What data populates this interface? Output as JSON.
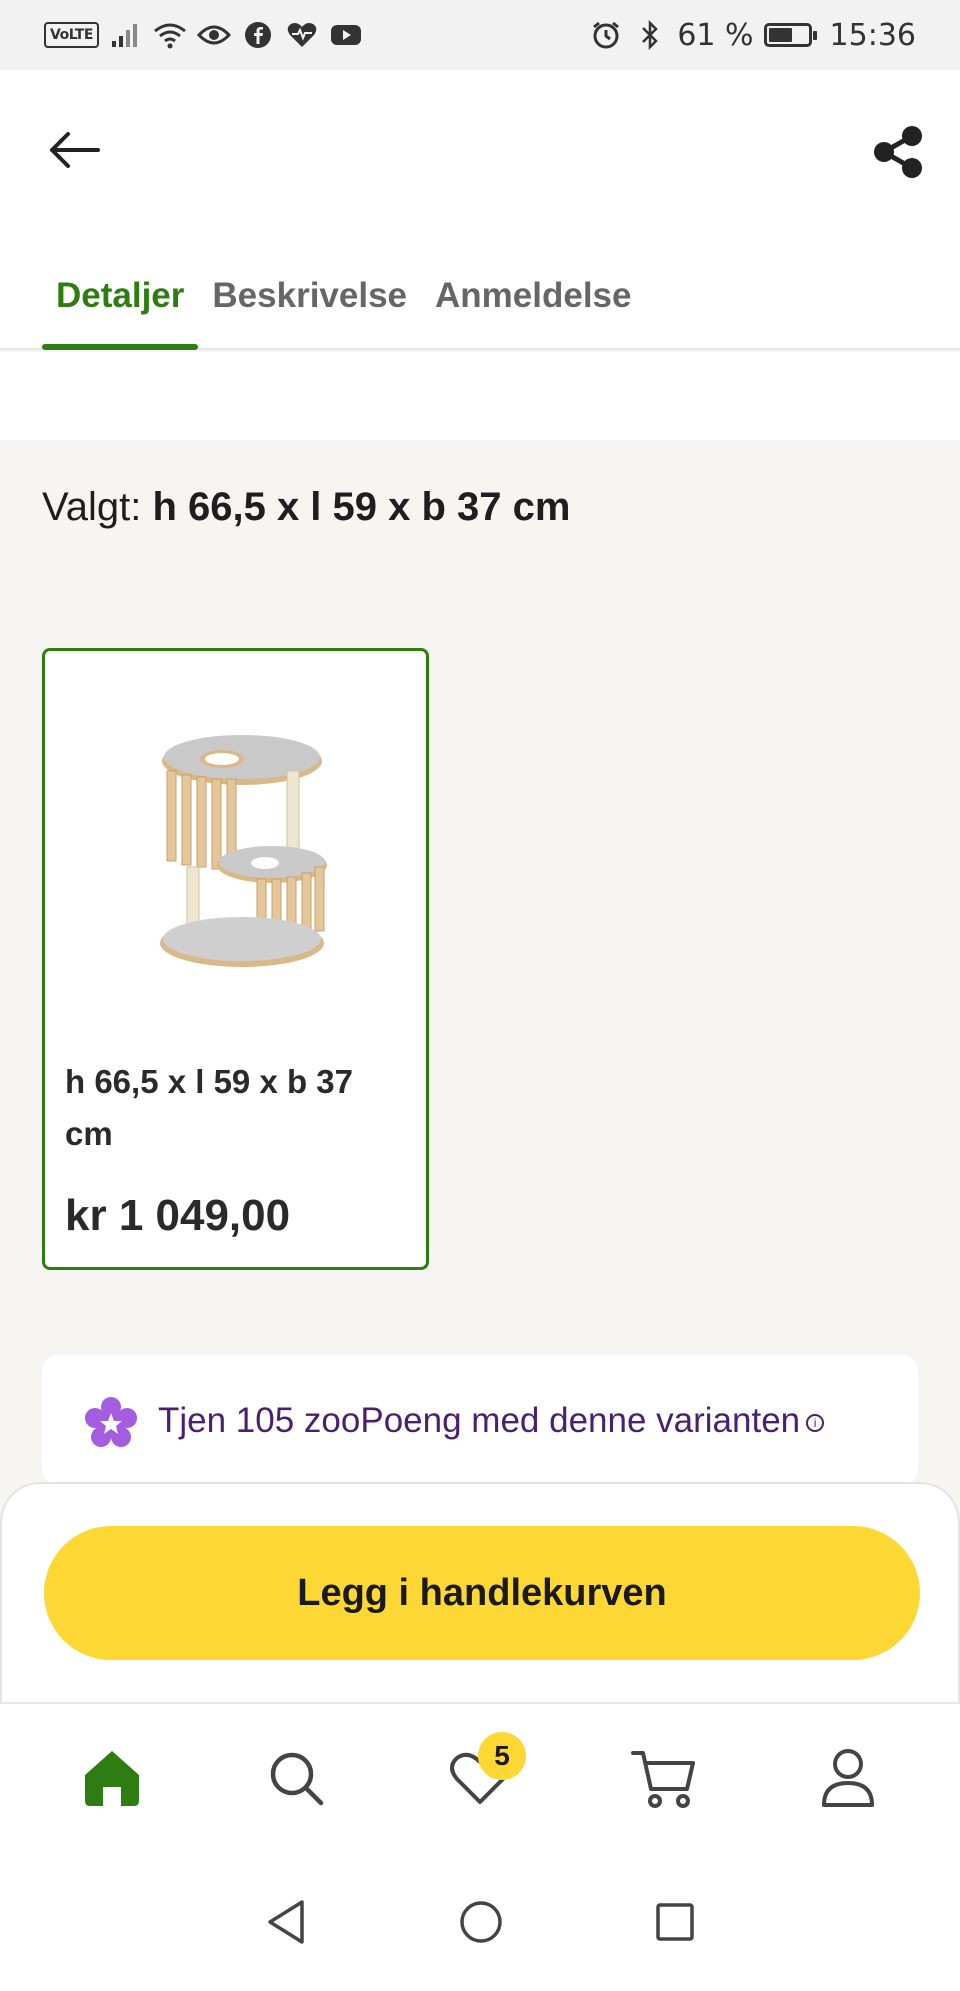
{
  "status_bar": {
    "volte": "VoLTE",
    "battery_text": "61 %",
    "battery_level": 0.61,
    "time": "15:36"
  },
  "header": {
    "tabs": [
      {
        "label": "Detaljer",
        "active": true
      },
      {
        "label": "Beskrivelse",
        "active": false
      },
      {
        "label": "Anmeldelse",
        "active": false
      }
    ]
  },
  "selection": {
    "prefix": "Valgt: ",
    "value": "h 66,5 x l 59 x b 37 cm"
  },
  "variant": {
    "name": "h 66,5 x l 59 x b 37 cm",
    "price": "kr 1 049,00"
  },
  "points": {
    "text": "Tjen 105 zooPoeng med denne varianten",
    "info_symbol": "i"
  },
  "cart": {
    "button_label": "Legg i handlekurven"
  },
  "bottom_nav": {
    "wishlist_count": "5"
  },
  "colors": {
    "accent_green": "#2d7d12",
    "button_yellow": "#fdd835",
    "points_purple": "#4b1f6f",
    "points_icon": "#a45ce0"
  }
}
